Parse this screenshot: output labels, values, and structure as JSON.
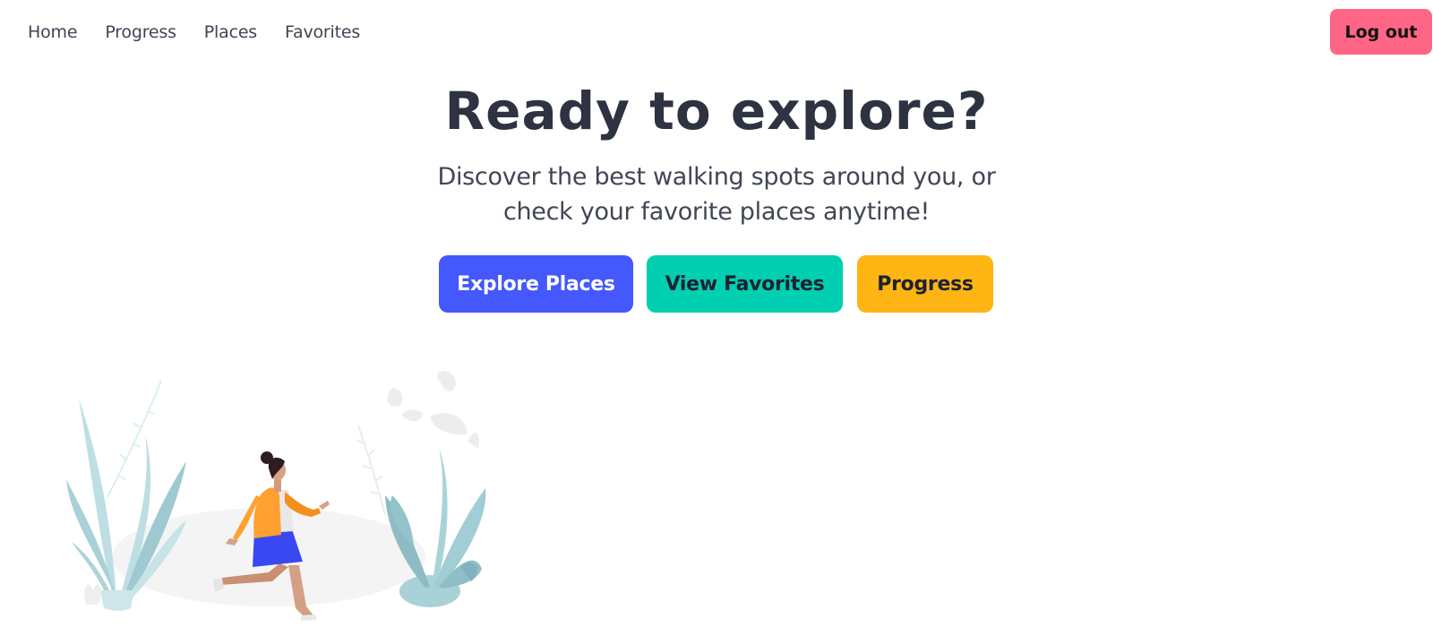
{
  "nav": {
    "links": [
      "Home",
      "Progress",
      "Places",
      "Favorites"
    ],
    "logout_label": "Log out"
  },
  "hero": {
    "title": "Ready to explore?",
    "subtitle": "Discover the best walking spots around you, or check your favorite places anytime!",
    "buttons": {
      "explore": "Explore Places",
      "favorites": "View Favorites",
      "progress": "Progress"
    }
  },
  "colors": {
    "logout": "#ff6685",
    "explore": "#4458fe",
    "favorites": "#00cfb1",
    "progress": "#ffb513",
    "title": "#2d3340"
  },
  "illustration": {
    "icon": "walking-woman-illustration"
  }
}
